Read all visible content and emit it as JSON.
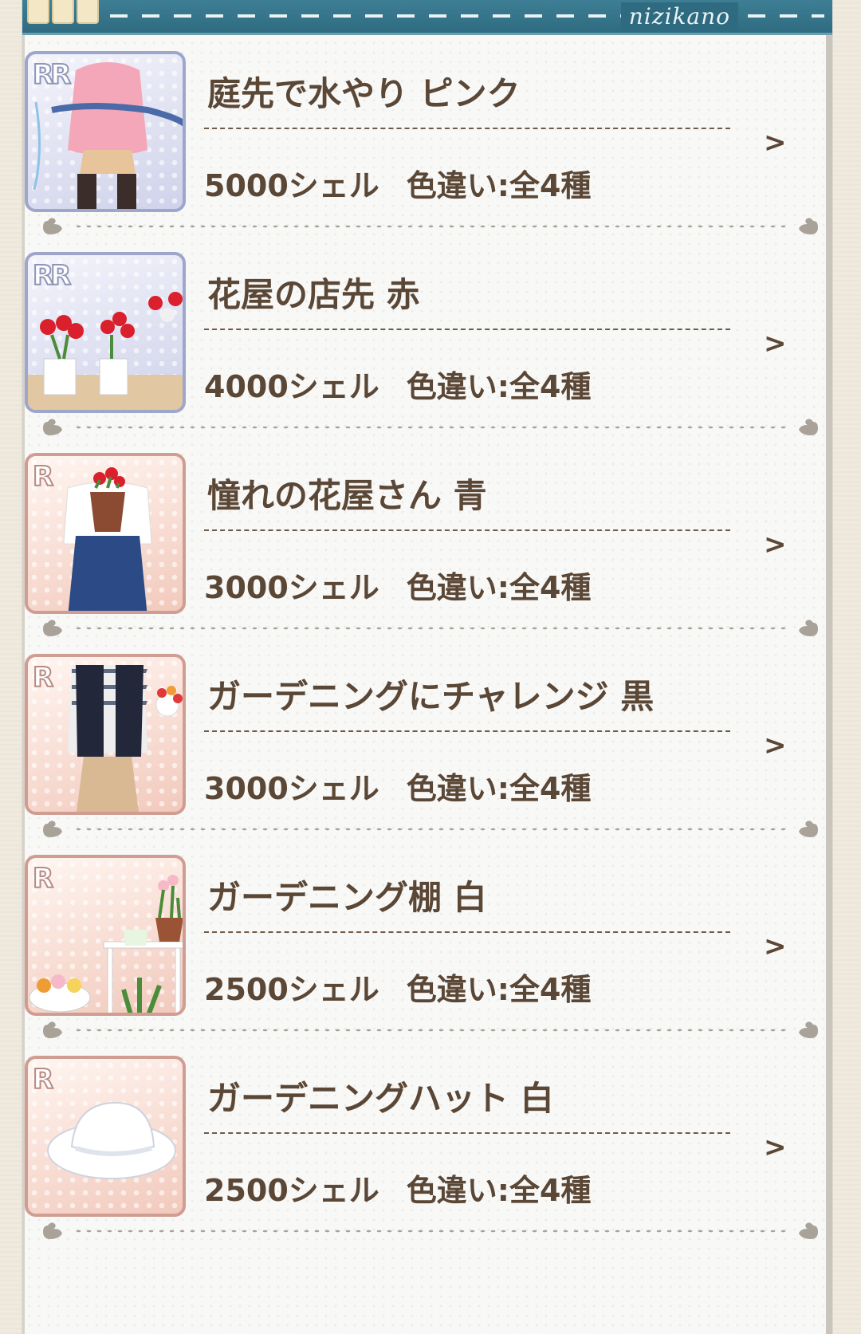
{
  "header": {
    "brand": "nizikano"
  },
  "items": [
    {
      "rarity": "RR",
      "name": "庭先で水やり ピンク",
      "price": "5000シェル",
      "variants": "色違い:全4種",
      "thumb": "pink-sweater-watering-outfit"
    },
    {
      "rarity": "RR",
      "name": "花屋の店先 赤",
      "price": "4000シェル",
      "variants": "色違い:全4種",
      "thumb": "red-flower-shop-display"
    },
    {
      "rarity": "R",
      "name": "憧れの花屋さん 青",
      "price": "3000シェル",
      "variants": "色違い:全4種",
      "thumb": "blue-apron-florist-outfit"
    },
    {
      "rarity": "R",
      "name": "ガーデニングにチャレンジ 黒",
      "price": "3000シェル",
      "variants": "色違い:全4種",
      "thumb": "black-vest-gardening-outfit"
    },
    {
      "rarity": "R",
      "name": "ガーデニング棚 白",
      "price": "2500シェル",
      "variants": "色違い:全4種",
      "thumb": "white-gardening-shelf"
    },
    {
      "rarity": "R",
      "name": "ガーデニングハット 白",
      "price": "2500シェル",
      "variants": "色違い:全4種",
      "thumb": "white-gardening-hat"
    }
  ],
  "arrow": ">",
  "colors": {
    "text": "#5b4736",
    "header": "#2f6b80",
    "rr_frame": "#9ea6cc",
    "r_frame": "#cf9d92"
  }
}
